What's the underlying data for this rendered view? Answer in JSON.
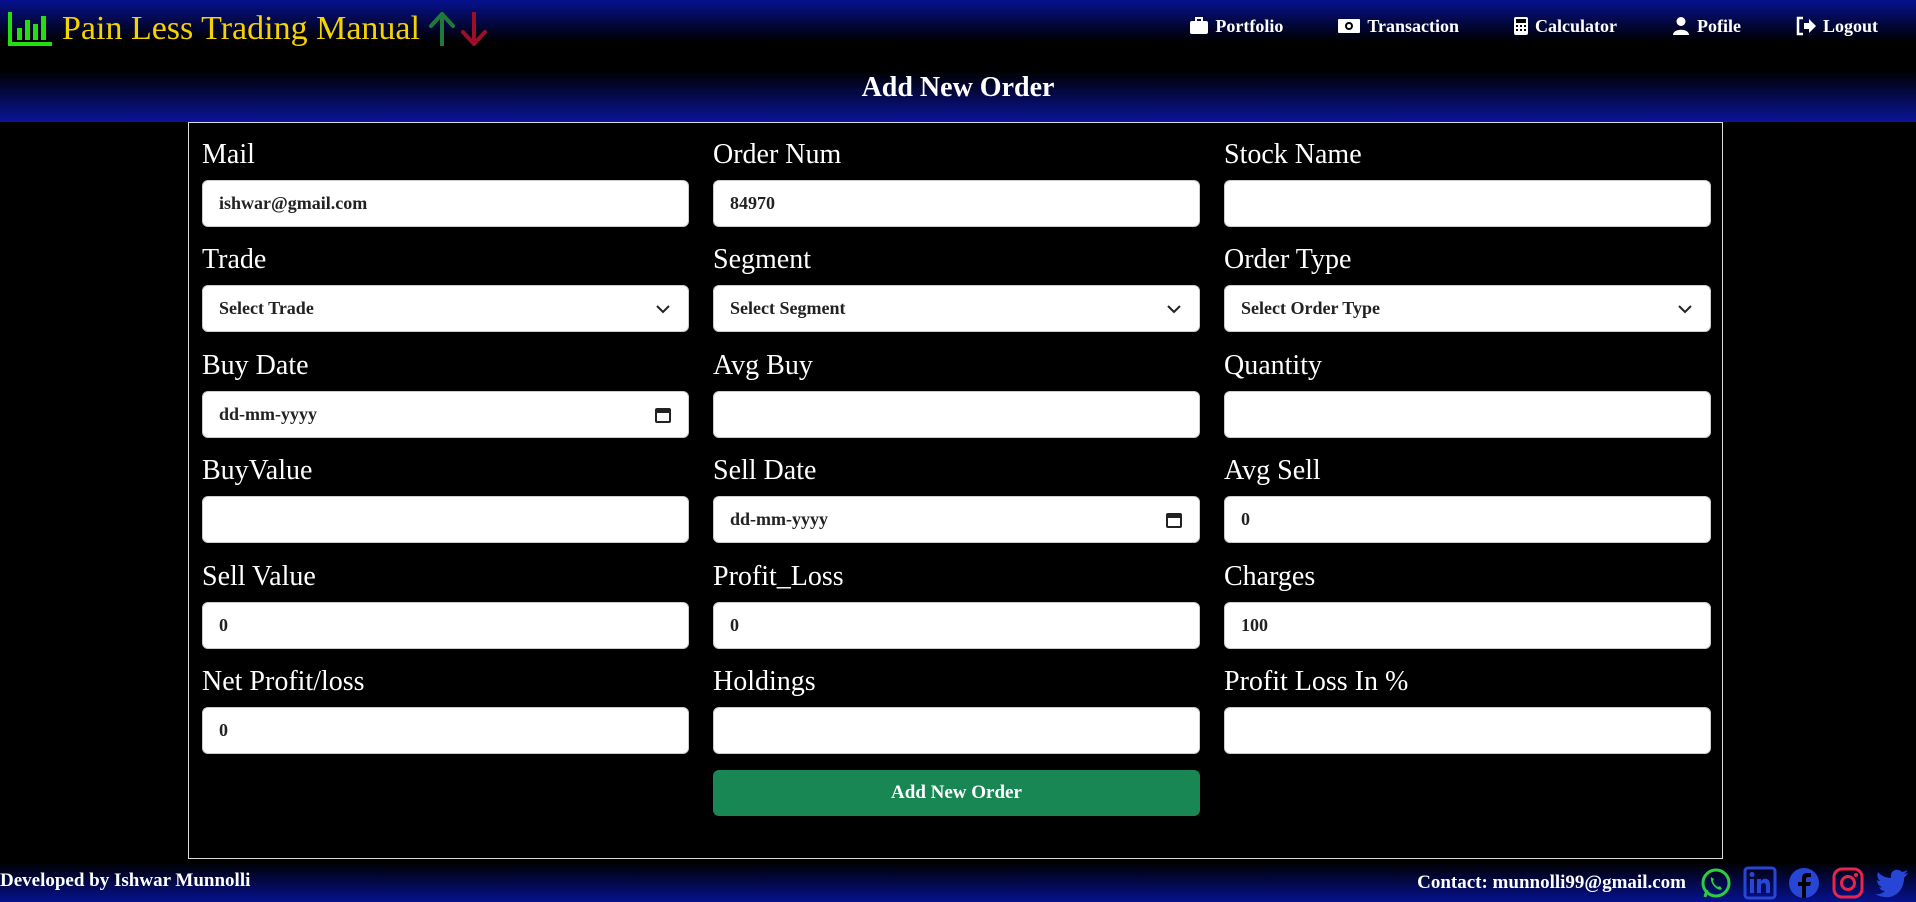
{
  "brand": {
    "title": "Pain Less Trading Manual"
  },
  "nav": [
    {
      "label": "Portfolio",
      "icon": "briefcase-icon"
    },
    {
      "label": "Transaction",
      "icon": "money-icon"
    },
    {
      "label": "Calculator",
      "icon": "calculator-icon"
    },
    {
      "label": "Pofile",
      "icon": "user-icon"
    },
    {
      "label": "Logout",
      "icon": "logout-icon"
    }
  ],
  "page": {
    "title": "Add New Order"
  },
  "fields": {
    "mail": {
      "label": "Mail",
      "value": "ishwar@gmail.com"
    },
    "order_num": {
      "label": "Order Num",
      "value": "84970"
    },
    "stock_name": {
      "label": "Stock Name",
      "value": ""
    },
    "trade": {
      "label": "Trade",
      "value": "Select Trade"
    },
    "segment": {
      "label": "Segment",
      "value": "Select Segment"
    },
    "order_type": {
      "label": "Order Type",
      "value": "Select Order Type"
    },
    "buy_date": {
      "label": "Buy Date",
      "value": "dd-mm-yyyy"
    },
    "avg_buy": {
      "label": "Avg Buy",
      "value": ""
    },
    "quantity": {
      "label": "Quantity",
      "value": ""
    },
    "buy_value": {
      "label": "BuyValue",
      "value": ""
    },
    "sell_date": {
      "label": "Sell Date",
      "value": "dd-mm-yyyy"
    },
    "avg_sell": {
      "label": "Avg Sell",
      "value": "0"
    },
    "sell_value": {
      "label": "Sell Value",
      "value": "0"
    },
    "profit_loss": {
      "label": "Profit_Loss",
      "value": "0"
    },
    "charges": {
      "label": "Charges",
      "value": "100"
    },
    "net_profit_loss": {
      "label": "Net Profit/loss",
      "value": "0"
    },
    "holdings": {
      "label": "Holdings",
      "value": ""
    },
    "profit_loss_pct": {
      "label": "Profit Loss In %",
      "value": ""
    }
  },
  "submit": {
    "label": "Add New Order"
  },
  "footer": {
    "developer": "Developed by Ishwar Munnolli",
    "contact": "Contact: munnolli99@gmail.com",
    "social": [
      "whatsapp-icon",
      "linkedin-icon",
      "facebook-icon",
      "instagram-icon",
      "twitter-icon"
    ]
  },
  "colors": {
    "brand_text": "#f5d300",
    "logo": "#22e00f",
    "arrow_up": "#1f7a3a",
    "arrow_down": "#9b1027",
    "submit": "#198754",
    "whatsapp": "#2ecc40",
    "linkedin": "#2746d6",
    "facebook": "#2746d6",
    "instagram": "#e6264a",
    "twitter": "#2746d6"
  }
}
